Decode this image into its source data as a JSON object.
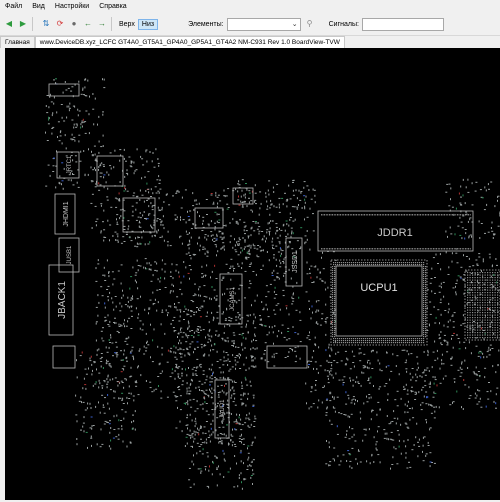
{
  "menu": [
    "Файл",
    "Вид",
    "Настройки",
    "Справка"
  ],
  "toolbar": {
    "icons": [
      "back-icon",
      "forward-icon",
      "flip-icon",
      "rotate-icon",
      "pin-icon",
      "arrow-left-icon",
      "arrow-right-icon"
    ],
    "view_label": "Верх",
    "view_toggle": "Низ",
    "elements_label": "Элементы:",
    "elements_value": "",
    "signals_label": "Сигналы:",
    "signals_value": ""
  },
  "tabs": {
    "main_label": "Главная",
    "file_label": "www.DeviceDB.xyz_LCFC GT4A0_GT5A1_GP4A0_GP5A1_GT4A2 NM-C931 Rev 1.0 BoardView-TVW"
  },
  "board": {
    "labels": [
      "JDDR1",
      "UCPU1",
      "JSSD1",
      "JBACK1",
      "JHDMI1",
      "JUSB1",
      "JRTC1",
      "JCAMS1",
      "JAUD1"
    ],
    "colors": {
      "background": "#000000",
      "outline": "#b8b8b8",
      "pin": "#9aa0a0",
      "accent_green": "#2e8b57",
      "accent_blue": "#3a5fcd",
      "accent_red": "#b03030"
    }
  }
}
